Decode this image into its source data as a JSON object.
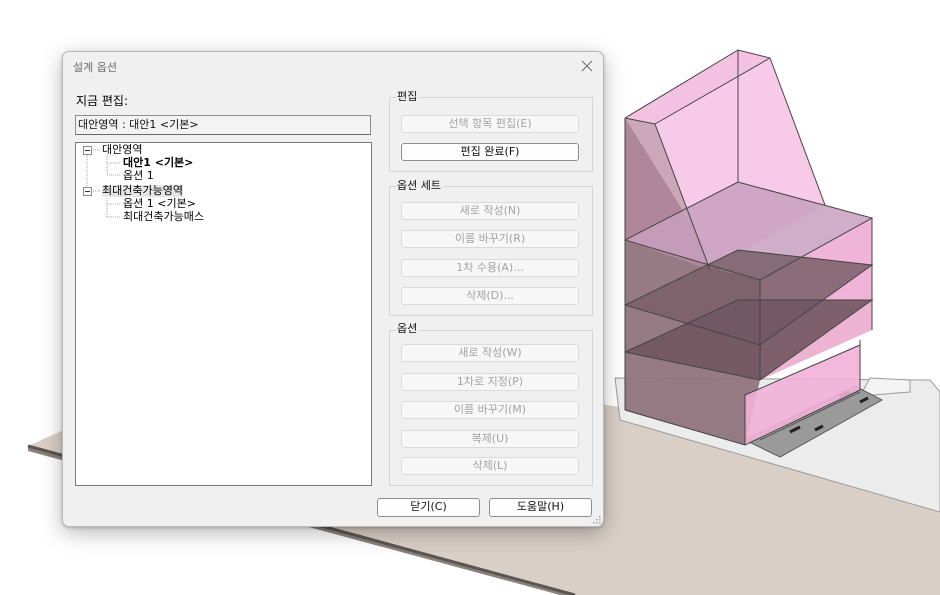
{
  "dialog": {
    "title": "설계 옵션",
    "current_edit_label": "지금 편집:",
    "current_edit_value": "대안영역 : 대안1 <기본>"
  },
  "tree": {
    "nodes": [
      {
        "label": "대안영역",
        "level": 0,
        "expanded": true
      },
      {
        "label": "대안1 <기본>",
        "level": 1,
        "bold": true
      },
      {
        "label": "옵션 1",
        "level": 1
      },
      {
        "label": "최대건축가능영역",
        "level": 0,
        "expanded": true,
        "selected": true
      },
      {
        "label": "옵션 1 <기본>",
        "level": 1
      },
      {
        "label": "최대건축가능매스",
        "level": 1
      }
    ]
  },
  "edit_group": {
    "title": "편집",
    "buttons": [
      {
        "label": "선택 항목 편집(E)",
        "enabled": false
      },
      {
        "label": "편집 완료(F)",
        "enabled": true
      }
    ]
  },
  "option_set_group": {
    "title": "옵션 세트",
    "buttons": [
      {
        "label": "새로 작성(N)",
        "enabled": false
      },
      {
        "label": "이름 바꾸기(R)",
        "enabled": false
      },
      {
        "label": "1차 수용(A)...",
        "enabled": false
      },
      {
        "label": "삭제(D)...",
        "enabled": false
      }
    ]
  },
  "option_group": {
    "title": "옵션",
    "buttons": [
      {
        "label": "새로 작성(W)",
        "enabled": false
      },
      {
        "label": "1차로 지정(P)",
        "enabled": false
      },
      {
        "label": "이름 바꾸기(M)",
        "enabled": false
      },
      {
        "label": "복제(U)",
        "enabled": false
      },
      {
        "label": "삭제(L)",
        "enabled": false
      }
    ]
  },
  "footer": {
    "close_label": "닫기(C)",
    "help_label": "도움말(H)"
  },
  "colors": {
    "mass_pink": "#f7b3de",
    "mass_dark": "#7a5f69",
    "ground": "#d8cdc4",
    "pad": "#ececec",
    "dialog_bg": "#f0f0f0"
  }
}
